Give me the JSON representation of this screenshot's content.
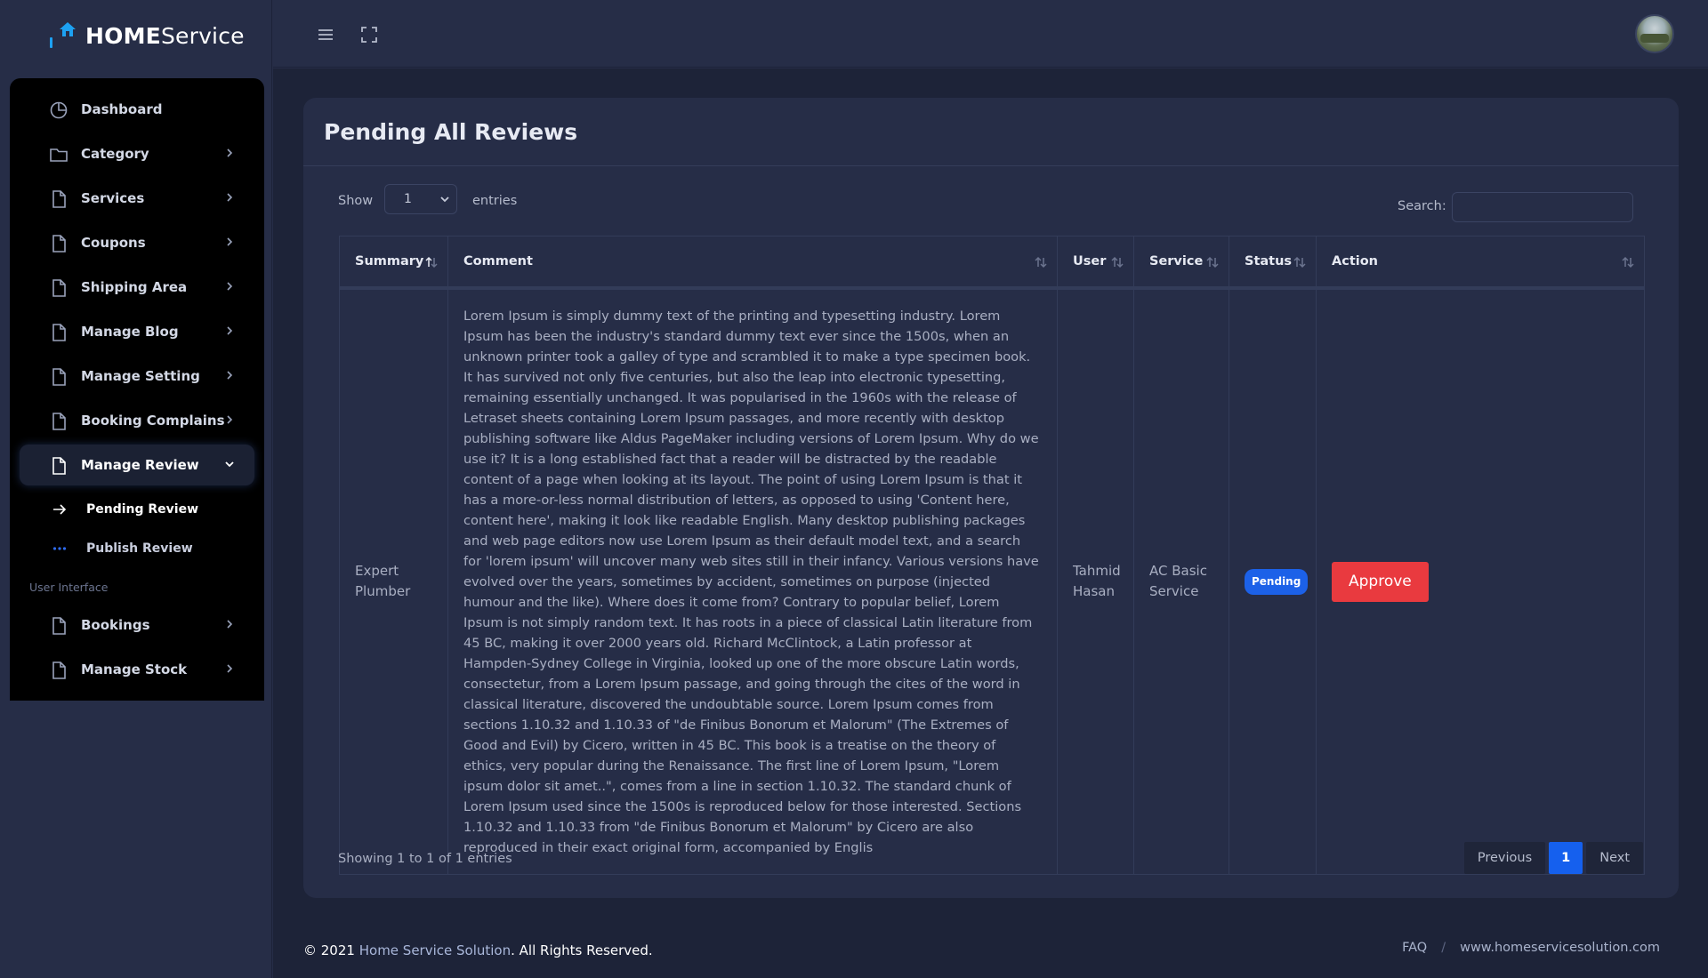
{
  "brand": {
    "bold": "HOME",
    "regular": "Service"
  },
  "sidebar": {
    "items": [
      {
        "label": "Dashboard",
        "icon": "dashboard-icon",
        "has_children": false
      },
      {
        "label": "Category",
        "icon": "folder-icon",
        "has_children": true
      },
      {
        "label": "Services",
        "icon": "file-icon",
        "has_children": true
      },
      {
        "label": "Coupons",
        "icon": "file-icon",
        "has_children": true
      },
      {
        "label": "Shipping Area",
        "icon": "file-icon",
        "has_children": true
      },
      {
        "label": "Manage Blog",
        "icon": "file-icon",
        "has_children": true
      },
      {
        "label": "Manage Setting",
        "icon": "file-icon",
        "has_children": true
      },
      {
        "label": "Booking Complains",
        "icon": "file-icon",
        "has_children": true
      },
      {
        "label": "Manage Review",
        "icon": "file-icon",
        "has_children": true,
        "expanded": true
      }
    ],
    "submenu": [
      {
        "label": "Pending Review",
        "icon": "arrow-right-icon",
        "active": true
      },
      {
        "label": "Publish Review",
        "icon": "dots-icon",
        "active": false
      }
    ],
    "section_label": "User Interface",
    "items2": [
      {
        "label": "Bookings",
        "icon": "file-icon",
        "has_children": true
      },
      {
        "label": "Manage Stock",
        "icon": "file-icon",
        "has_children": true
      }
    ]
  },
  "topbar": {
    "menu_icon": "hamburger-icon",
    "fullscreen_icon": "fullscreen-icon"
  },
  "page": {
    "title": "Pending All Reviews",
    "show_label": "Show",
    "show_value": "1",
    "entries_label": "entries",
    "search_label": "Search:",
    "search_value": ""
  },
  "table": {
    "columns": [
      "Summary",
      "Comment",
      "User",
      "Service",
      "Status",
      "Action"
    ],
    "rows": [
      {
        "summary": "Expert Plumber",
        "comment": "Lorem Ipsum is simply dummy text of the printing and typesetting industry. Lorem Ipsum has been the industry's standard dummy text ever since the 1500s, when an unknown printer took a galley of type and scrambled it to make a type specimen book. It has survived not only five centuries, but also the leap into electronic typesetting, remaining essentially unchanged. It was popularised in the 1960s with the release of Letraset sheets containing Lorem Ipsum passages, and more recently with desktop publishing software like Aldus PageMaker including versions of Lorem Ipsum. Why do we use it? It is a long established fact that a reader will be distracted by the readable content of a page when looking at its layout. The point of using Lorem Ipsum is that it has a more-or-less normal distribution of letters, as opposed to using 'Content here, content here', making it look like readable English. Many desktop publishing packages and web page editors now use Lorem Ipsum as their default model text, and a search for 'lorem ipsum' will uncover many web sites still in their infancy. Various versions have evolved over the years, sometimes by accident, sometimes on purpose (injected humour and the like). Where does it come from? Contrary to popular belief, Lorem Ipsum is not simply random text. It has roots in a piece of classical Latin literature from 45 BC, making it over 2000 years old. Richard McClintock, a Latin professor at Hampden-Sydney College in Virginia, looked up one of the more obscure Latin words, consectetur, from a Lorem Ipsum passage, and going through the cites of the word in classical literature, discovered the undoubtable source. Lorem Ipsum comes from sections 1.10.32 and 1.10.33 of \"de Finibus Bonorum et Malorum\" (The Extremes of Good and Evil) by Cicero, written in 45 BC. This book is a treatise on the theory of ethics, very popular during the Renaissance. The first line of Lorem Ipsum, \"Lorem ipsum dolor sit amet..\", comes from a line in section 1.10.32. The standard chunk of Lorem Ipsum used since the 1500s is reproduced below for those interested. Sections 1.10.32 and 1.10.33 from \"de Finibus Bonorum et Malorum\" by Cicero are also reproduced in their exact original form, accompanied by Englis",
        "user": "Tahmid Hasan",
        "service": "AC Basic Service",
        "status": "Pending",
        "action": "Approve"
      }
    ]
  },
  "pagination": {
    "info": "Showing 1 to 1 of 1 entries",
    "previous": "Previous",
    "current": "1",
    "next": "Next"
  },
  "footer": {
    "copyright_prefix": "© 2021",
    "company": "Home Service Solution",
    "rights": ". All Rights Reserved.",
    "faq": "FAQ",
    "separator": "/",
    "website": "www.homeservicesolution.com"
  },
  "colors": {
    "accent": "#1560ee",
    "danger": "#e93a3f",
    "brand_icon": "#1da1f2",
    "sidebar_panel": "#000000",
    "page_bg": "#1d2338",
    "card_bg": "#262d47"
  }
}
